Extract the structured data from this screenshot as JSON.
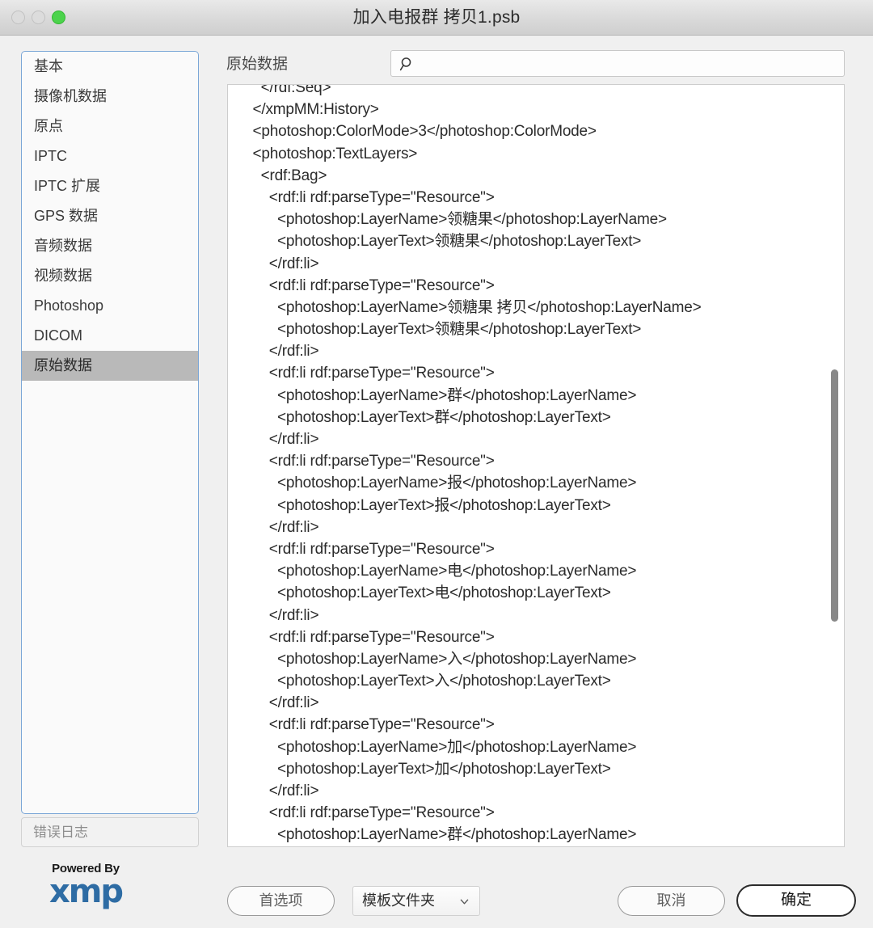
{
  "window": {
    "title": "加入电报群 拷贝1.psb",
    "traffic_lights": [
      "close-button",
      "minimize-button",
      "maximize-button"
    ],
    "colors": {
      "maximize_green": "#4cd34c",
      "disabled_gray": "#dcdcdc",
      "selection_gray": "#b9b9b9",
      "list_border_blue": "#7ba7d7",
      "xmp_blue": "#2e6ca4"
    }
  },
  "sidebar": {
    "items": [
      {
        "label": "基本",
        "selected": false
      },
      {
        "label": "摄像机数据",
        "selected": false
      },
      {
        "label": "原点",
        "selected": false
      },
      {
        "label": "IPTC",
        "selected": false
      },
      {
        "label": "IPTC 扩展",
        "selected": false
      },
      {
        "label": "GPS 数据",
        "selected": false
      },
      {
        "label": "音频数据",
        "selected": false
      },
      {
        "label": "视频数据",
        "selected": false
      },
      {
        "label": "Photoshop",
        "selected": false
      },
      {
        "label": "DICOM",
        "selected": false
      },
      {
        "label": "原始数据",
        "selected": true
      }
    ],
    "error_log_label": "错误日志",
    "logo": {
      "powered_by": "Powered By",
      "wordmark": "xmp"
    }
  },
  "main": {
    "pane_label": "原始数据",
    "search": {
      "value": "",
      "placeholder": "",
      "icon": "search-icon"
    },
    "xml_lines": [
      {
        "indent": 4,
        "text": "</rdf:Seq>"
      },
      {
        "indent": 3,
        "text": "</xmpMM:History>"
      },
      {
        "indent": 3,
        "text": "<photoshop:ColorMode>3</photoshop:ColorMode>"
      },
      {
        "indent": 3,
        "text": "<photoshop:TextLayers>"
      },
      {
        "indent": 4,
        "text": "<rdf:Bag>"
      },
      {
        "indent": 5,
        "text": "<rdf:li rdf:parseType=\"Resource\">"
      },
      {
        "indent": 6,
        "text": "<photoshop:LayerName>领糖果</photoshop:LayerName>"
      },
      {
        "indent": 6,
        "text": "<photoshop:LayerText>领糖果</photoshop:LayerText>"
      },
      {
        "indent": 5,
        "text": "</rdf:li>"
      },
      {
        "indent": 5,
        "text": "<rdf:li rdf:parseType=\"Resource\">"
      },
      {
        "indent": 6,
        "text": "<photoshop:LayerName>领糖果 拷贝</photoshop:LayerName>"
      },
      {
        "indent": 6,
        "text": "<photoshop:LayerText>领糖果</photoshop:LayerText>"
      },
      {
        "indent": 5,
        "text": "</rdf:li>"
      },
      {
        "indent": 5,
        "text": "<rdf:li rdf:parseType=\"Resource\">"
      },
      {
        "indent": 6,
        "text": "<photoshop:LayerName>群</photoshop:LayerName>"
      },
      {
        "indent": 6,
        "text": "<photoshop:LayerText>群</photoshop:LayerText>"
      },
      {
        "indent": 5,
        "text": "</rdf:li>"
      },
      {
        "indent": 5,
        "text": "<rdf:li rdf:parseType=\"Resource\">"
      },
      {
        "indent": 6,
        "text": "<photoshop:LayerName>报</photoshop:LayerName>"
      },
      {
        "indent": 6,
        "text": "<photoshop:LayerText>报</photoshop:LayerText>"
      },
      {
        "indent": 5,
        "text": "</rdf:li>"
      },
      {
        "indent": 5,
        "text": "<rdf:li rdf:parseType=\"Resource\">"
      },
      {
        "indent": 6,
        "text": "<photoshop:LayerName>电</photoshop:LayerName>"
      },
      {
        "indent": 6,
        "text": "<photoshop:LayerText>电</photoshop:LayerText>"
      },
      {
        "indent": 5,
        "text": "</rdf:li>"
      },
      {
        "indent": 5,
        "text": "<rdf:li rdf:parseType=\"Resource\">"
      },
      {
        "indent": 6,
        "text": "<photoshop:LayerName>入</photoshop:LayerName>"
      },
      {
        "indent": 6,
        "text": "<photoshop:LayerText>入</photoshop:LayerText>"
      },
      {
        "indent": 5,
        "text": "</rdf:li>"
      },
      {
        "indent": 5,
        "text": "<rdf:li rdf:parseType=\"Resource\">"
      },
      {
        "indent": 6,
        "text": "<photoshop:LayerName>加</photoshop:LayerName>"
      },
      {
        "indent": 6,
        "text": "<photoshop:LayerText>加</photoshop:LayerText>"
      },
      {
        "indent": 5,
        "text": "</rdf:li>"
      },
      {
        "indent": 5,
        "text": "<rdf:li rdf:parseType=\"Resource\">"
      },
      {
        "indent": 6,
        "text": "<photoshop:LayerName>群</photoshop:LayerName>"
      }
    ]
  },
  "footer": {
    "preferences_label": "首选项",
    "template_folder_label": "模板文件夹",
    "cancel_label": "取消",
    "ok_label": "确定"
  }
}
